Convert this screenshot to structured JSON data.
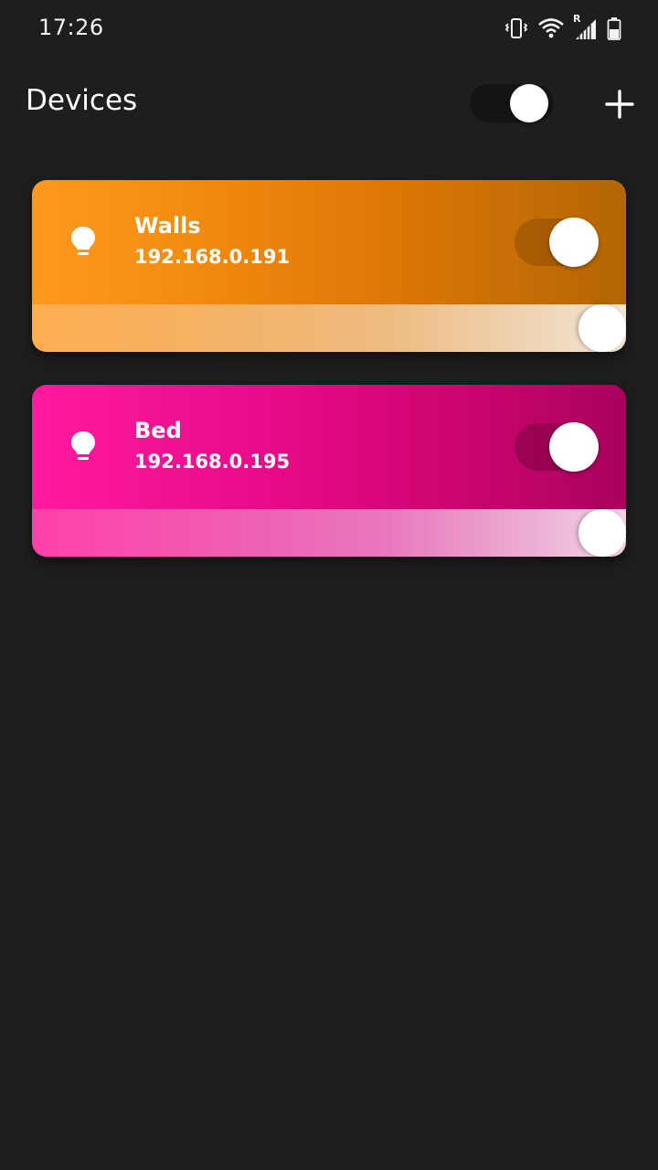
{
  "status_bar": {
    "time": "17:26",
    "icons": [
      "vibrate-icon",
      "wifi-icon",
      "signal-roaming-icon",
      "battery-icon"
    ],
    "roaming_label": "R"
  },
  "header": {
    "title": "Devices",
    "master_toggle_on": true,
    "add_icon": "plus-icon"
  },
  "devices": [
    {
      "name": "Walls",
      "ip": "192.168.0.191",
      "on": true,
      "brightness": 1.0,
      "color": "#f28c10",
      "icon": "lightbulb-icon"
    },
    {
      "name": "Bed",
      "ip": "192.168.0.195",
      "on": true,
      "brightness": 1.0,
      "color": "#e8098a",
      "icon": "lightbulb-icon"
    }
  ],
  "colors": {
    "background": "#1e1e1e",
    "text": "#ffffff"
  }
}
